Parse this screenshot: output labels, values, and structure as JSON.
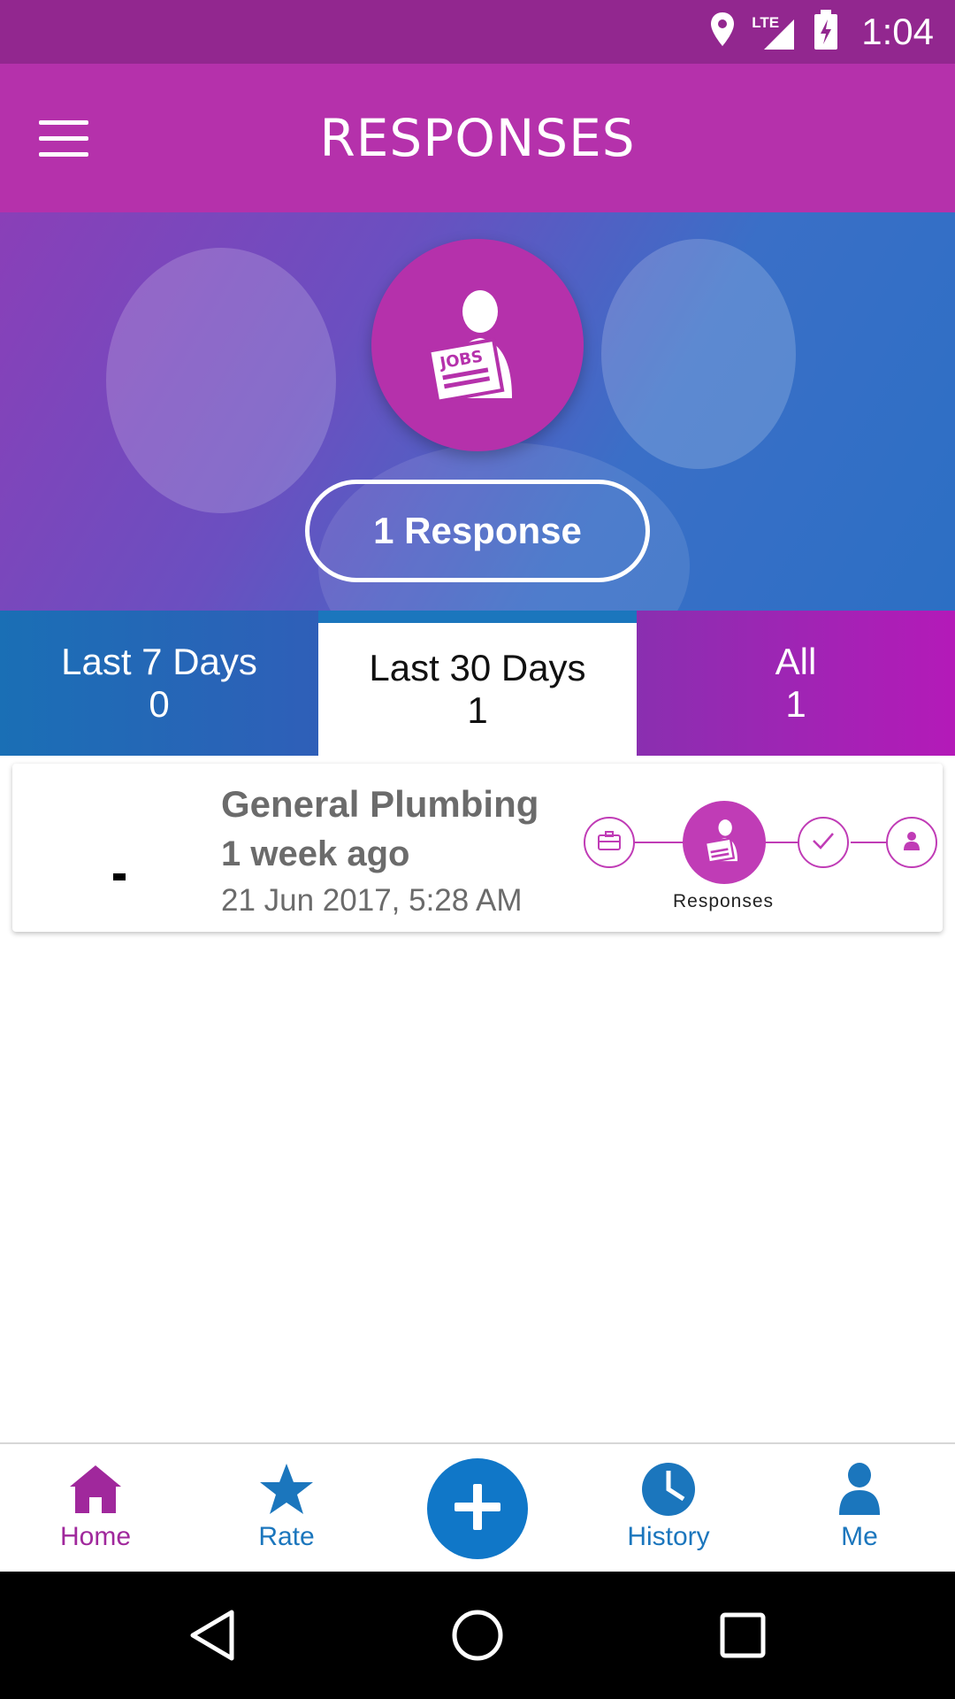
{
  "status_bar": {
    "time": "1:04",
    "network": "LTE"
  },
  "app_bar": {
    "title": "RESPONSES"
  },
  "hero": {
    "icon_text": "JOBS",
    "response_label": "1 Response"
  },
  "tabs": [
    {
      "label": "Last 7 Days",
      "count": "0"
    },
    {
      "label": "Last 30 Days",
      "count": "1"
    },
    {
      "label": "All",
      "count": "1"
    }
  ],
  "card": {
    "title": "General Plumbing",
    "time_ago": "1 week ago",
    "date": "21 Jun 2017, 5:28 AM",
    "active_step_label": "Responses"
  },
  "bottom_nav": {
    "home": "Home",
    "rate": "Rate",
    "history": "History",
    "me": "Me"
  },
  "colors": {
    "primary": "#b531ab",
    "status_bar": "#92278f",
    "accent_blue": "#1b76bd"
  }
}
